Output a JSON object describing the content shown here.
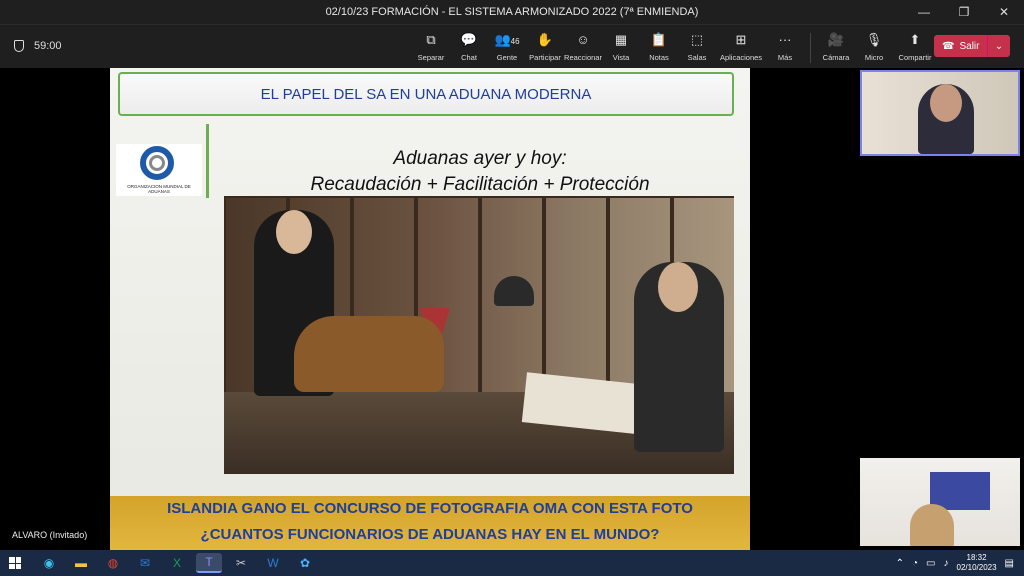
{
  "window": {
    "title": "02/10/23 FORMACIÓN - EL SISTEMA ARMONIZADO 2022 (7ª ENMIENDA)",
    "minimize": "—",
    "restore": "❐",
    "close": "✕"
  },
  "toolbar": {
    "timer": "59:00",
    "tools": [
      {
        "label": "Separar",
        "icon": "pop-out-icon",
        "glyph": "⧉"
      },
      {
        "label": "Chat",
        "icon": "chat-icon",
        "glyph": "💬"
      },
      {
        "label": "Gente",
        "icon": "people-icon",
        "glyph": "👥",
        "count": "46"
      },
      {
        "label": "Participar",
        "icon": "raise-hand-icon",
        "glyph": "✋"
      },
      {
        "label": "Reaccionar",
        "icon": "emoji-icon",
        "glyph": "☺"
      },
      {
        "label": "Vista",
        "icon": "view-icon",
        "glyph": "▦"
      },
      {
        "label": "Notas",
        "icon": "notes-icon",
        "glyph": "📋"
      },
      {
        "label": "Salas",
        "icon": "rooms-icon",
        "glyph": "⬚"
      },
      {
        "label": "Aplicaciones",
        "icon": "apps-icon",
        "glyph": "⊞"
      },
      {
        "label": "Más",
        "icon": "more-icon",
        "glyph": "···"
      }
    ],
    "camera": {
      "label": "Cámara",
      "glyph": "🎥"
    },
    "mic": {
      "label": "Micro",
      "glyph": "🎙"
    },
    "share": {
      "label": "Compartir",
      "glyph": "⬆"
    },
    "leave": {
      "label": "Salir"
    }
  },
  "slide": {
    "header": "EL PAPEL DEL SA EN UNA ADUANA MODERNA",
    "logo_text": "ORGANIZACION MUNDIAL DE ADUANAS",
    "caption_line1": "Aduanas ayer y hoy:",
    "caption_line2": "Recaudación + Facilitación + Protección",
    "banner_line1": "ISLANDIA GANO EL CONCURSO DE FOTOGRAFIA OMA CON ESTA FOTO",
    "banner_line2": "¿CUANTOS FUNCIONARIOS DE ADUANAS HAY EN EL MUNDO?"
  },
  "presenter_name": "ALVARO (Invitado)",
  "taskbar": {
    "time": "18:32",
    "date": "02/10/2023"
  }
}
